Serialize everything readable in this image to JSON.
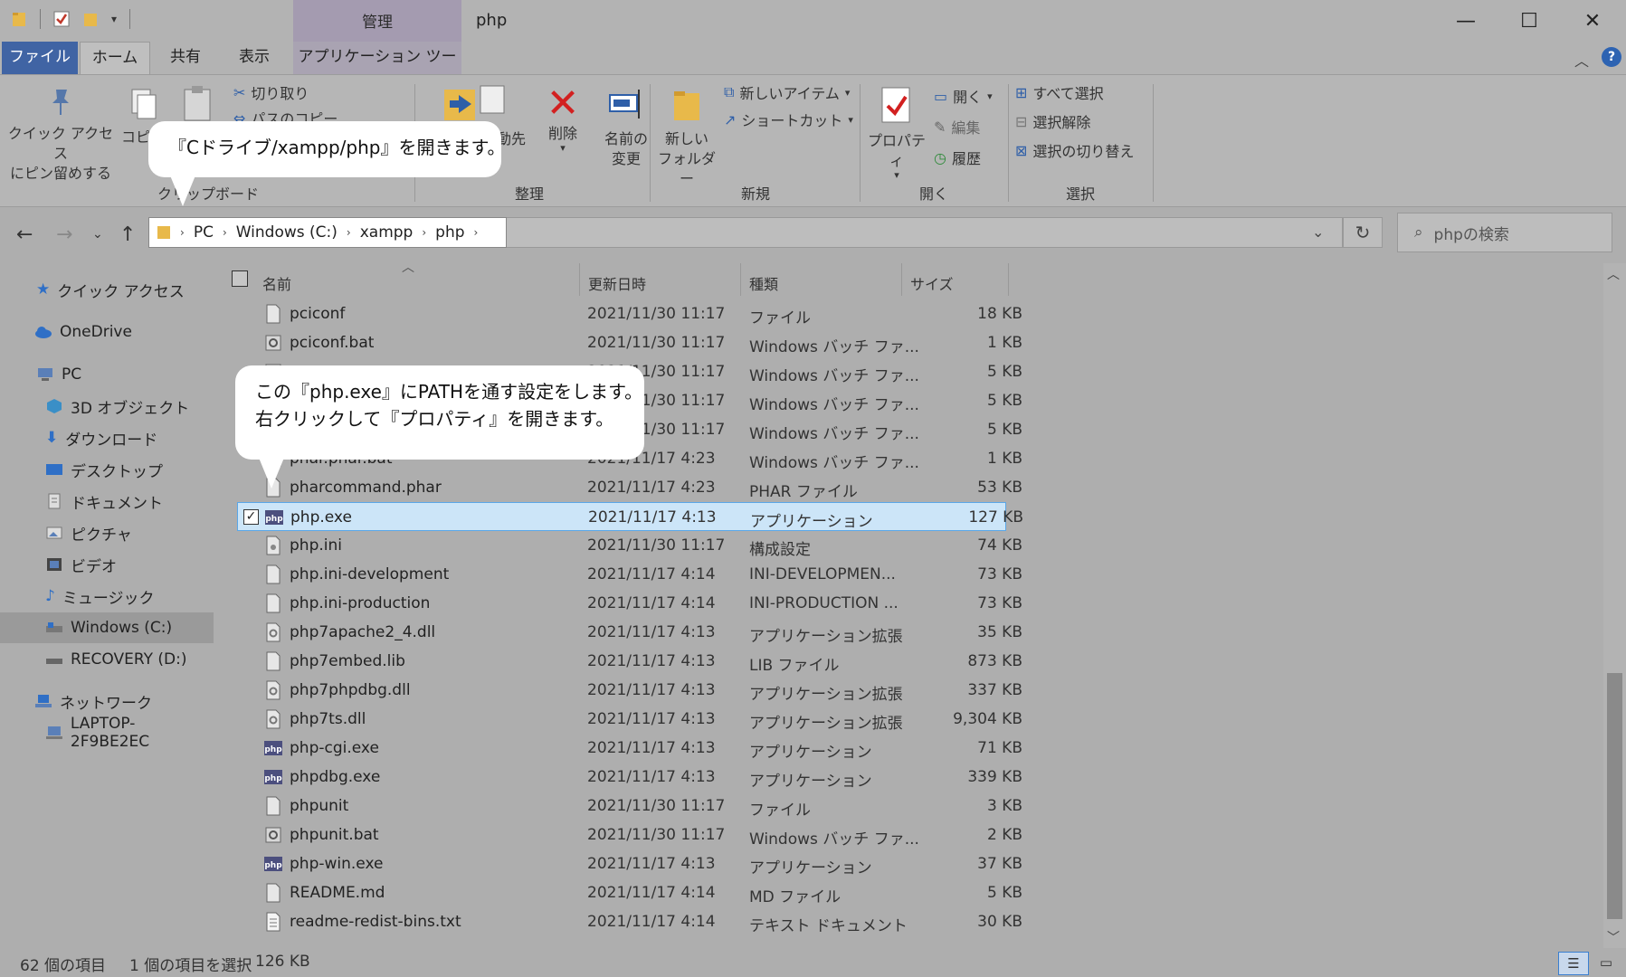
{
  "window": {
    "title": "php",
    "context_tab_group": "管理",
    "minimize": "—",
    "maximize": "☐",
    "close": "✕"
  },
  "tabs": {
    "file": "ファイル",
    "home": "ホーム",
    "share": "共有",
    "view": "表示",
    "app_tools": "アプリケーション ツール"
  },
  "ribbon": {
    "clipboard": {
      "label": "クリップボード",
      "pin_line1": "クイック アクセス",
      "pin_line2": "にピン留めする",
      "copy": "コピー",
      "cut": "切り取り",
      "copy_path": "パスのコピー"
    },
    "organize": {
      "label": "整理",
      "move_to": "移動先",
      "delete": "削除",
      "rename_line1": "名前の",
      "rename_line2": "変更"
    },
    "new": {
      "label": "新規",
      "new_item": "新しいアイテム",
      "shortcut": "ショートカット",
      "new_folder_line1": "新しい",
      "new_folder_line2": "フォルダー"
    },
    "open": {
      "label": "開く",
      "properties": "プロパティ",
      "open": "開く",
      "edit": "編集",
      "history": "履歴"
    },
    "select": {
      "label": "選択",
      "select_all": "すべて選択",
      "select_none": "選択解除",
      "invert": "選択の切り替え"
    }
  },
  "address": {
    "crumbs": [
      "PC",
      "Windows (C:)",
      "xampp",
      "php"
    ],
    "search_placeholder": "phpの検索"
  },
  "nav": {
    "items": [
      {
        "label": "クイック アクセス",
        "icon": "star-icon"
      },
      {
        "label": "OneDrive",
        "icon": "cloud-icon"
      },
      {
        "label": "PC",
        "icon": "pc-icon"
      },
      {
        "label": "3D オブジェクト",
        "icon": "cube-icon"
      },
      {
        "label": "ダウンロード",
        "icon": "download-icon"
      },
      {
        "label": "デスクトップ",
        "icon": "desktop-icon"
      },
      {
        "label": "ドキュメント",
        "icon": "document-icon"
      },
      {
        "label": "ピクチャ",
        "icon": "picture-icon"
      },
      {
        "label": "ビデオ",
        "icon": "video-icon"
      },
      {
        "label": "ミュージック",
        "icon": "music-icon"
      },
      {
        "label": "Windows (C:)",
        "icon": "drive-icon"
      },
      {
        "label": "RECOVERY (D:)",
        "icon": "drive-icon"
      },
      {
        "label": "ネットワーク",
        "icon": "network-icon"
      },
      {
        "label": "LAPTOP-2F9BE2EC",
        "icon": "computer-icon"
      }
    ]
  },
  "columns": {
    "name": "名前",
    "date": "更新日時",
    "type": "種類",
    "size": "サイズ"
  },
  "files": [
    {
      "name": "pciconf",
      "date": "2021/11/30 11:17",
      "type": "ファイル",
      "size": "18 KB",
      "icon": "file"
    },
    {
      "name": "pciconf.bat",
      "date": "2021/11/30 11:17",
      "type": "Windows バッチ ファ...",
      "size": "1 KB",
      "icon": "bat"
    },
    {
      "name": "",
      "date": "2021/11/30 11:17",
      "type": "Windows バッチ ファ...",
      "size": "5 KB",
      "icon": "bat"
    },
    {
      "name": "",
      "date": "2021/11/30 11:17",
      "type": "Windows バッチ ファ...",
      "size": "5 KB",
      "icon": "bat"
    },
    {
      "name": "",
      "date": "2021/11/30 11:17",
      "type": "Windows バッチ ファ...",
      "size": "5 KB",
      "icon": "bat"
    },
    {
      "name": "phar.phar.bat",
      "date": "2021/11/17 4:23",
      "type": "Windows バッチ ファ...",
      "size": "1 KB",
      "icon": "bat"
    },
    {
      "name": "pharcommand.phar",
      "date": "2021/11/17 4:23",
      "type": "PHAR ファイル",
      "size": "53 KB",
      "icon": "file"
    },
    {
      "name": "php.exe",
      "date": "2021/11/17 4:13",
      "type": "アプリケーション",
      "size": "127 KB",
      "icon": "php",
      "selected": true
    },
    {
      "name": "php.ini",
      "date": "2021/11/30 11:17",
      "type": "構成設定",
      "size": "74 KB",
      "icon": "ini"
    },
    {
      "name": "php.ini-development",
      "date": "2021/11/17 4:14",
      "type": "INI-DEVELOPMEN...",
      "size": "73 KB",
      "icon": "file"
    },
    {
      "name": "php.ini-production",
      "date": "2021/11/17 4:14",
      "type": "INI-PRODUCTION ...",
      "size": "73 KB",
      "icon": "file"
    },
    {
      "name": "php7apache2_4.dll",
      "date": "2021/11/17 4:13",
      "type": "アプリケーション拡張",
      "size": "35 KB",
      "icon": "dll"
    },
    {
      "name": "php7embed.lib",
      "date": "2021/11/17 4:13",
      "type": "LIB ファイル",
      "size": "873 KB",
      "icon": "file"
    },
    {
      "name": "php7phpdbg.dll",
      "date": "2021/11/17 4:13",
      "type": "アプリケーション拡張",
      "size": "337 KB",
      "icon": "dll"
    },
    {
      "name": "php7ts.dll",
      "date": "2021/11/17 4:13",
      "type": "アプリケーション拡張",
      "size": "9,304 KB",
      "icon": "dll"
    },
    {
      "name": "php-cgi.exe",
      "date": "2021/11/17 4:13",
      "type": "アプリケーション",
      "size": "71 KB",
      "icon": "php"
    },
    {
      "name": "phpdbg.exe",
      "date": "2021/11/17 4:13",
      "type": "アプリケーション",
      "size": "339 KB",
      "icon": "php"
    },
    {
      "name": "phpunit",
      "date": "2021/11/30 11:17",
      "type": "ファイル",
      "size": "3 KB",
      "icon": "file"
    },
    {
      "name": "phpunit.bat",
      "date": "2021/11/30 11:17",
      "type": "Windows バッチ ファ...",
      "size": "2 KB",
      "icon": "bat"
    },
    {
      "name": "php-win.exe",
      "date": "2021/11/17 4:13",
      "type": "アプリケーション",
      "size": "37 KB",
      "icon": "php"
    },
    {
      "name": "README.md",
      "date": "2021/11/17 4:14",
      "type": "MD ファイル",
      "size": "5 KB",
      "icon": "file"
    },
    {
      "name": "readme-redist-bins.txt",
      "date": "2021/11/17 4:14",
      "type": "テキスト ドキュメント",
      "size": "30 KB",
      "icon": "txt"
    }
  ],
  "status": {
    "count": "62 個の項目",
    "selection": "1 個の項目を選択",
    "size": "126 KB"
  },
  "callouts": {
    "top": "『Cドライブ/xampp/php』を開きます。",
    "middle_line1": "この『php.exe』にPATHを通す設定をします。",
    "middle_line2": "右クリックして『プロパティ』を開きます。"
  },
  "colors": {
    "file_tab": "#4064a4",
    "selection": "#cce5f8",
    "selection_border": "#5aa7e8",
    "delete_red": "#d22020"
  }
}
